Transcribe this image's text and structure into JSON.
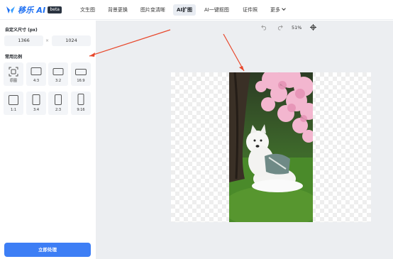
{
  "brand": {
    "name": "移乐 AI",
    "badge": "beta",
    "accent": "#1d6ff2"
  },
  "nav": {
    "items": [
      {
        "label": "文生图"
      },
      {
        "label": "背景更换"
      },
      {
        "label": "图片变清晰"
      },
      {
        "label": "AI扩图",
        "active": true
      },
      {
        "label": "AI一键抠图"
      },
      {
        "label": "证件照"
      },
      {
        "label": "更多"
      }
    ]
  },
  "sidebar": {
    "custom_size_title": "自定义尺寸 (px)",
    "width_value": "1366",
    "height_value": "1024",
    "times": "×",
    "ratio_title": "常用比例",
    "ratios": [
      {
        "label": "原图"
      },
      {
        "label": "4:3"
      },
      {
        "label": "3:2"
      },
      {
        "label": "16:9"
      },
      {
        "label": "1:1"
      },
      {
        "label": "3:4"
      },
      {
        "label": "2:3"
      },
      {
        "label": "9:16"
      }
    ],
    "cta_label": "立即处理",
    "cta_color": "#3d7ef5"
  },
  "toolbar": {
    "undo_icon": "undo-icon",
    "redo_icon": "redo-icon",
    "zoom": "51%",
    "fit_icon": "crosshair-icon"
  },
  "annotation_color": "#e8472b"
}
